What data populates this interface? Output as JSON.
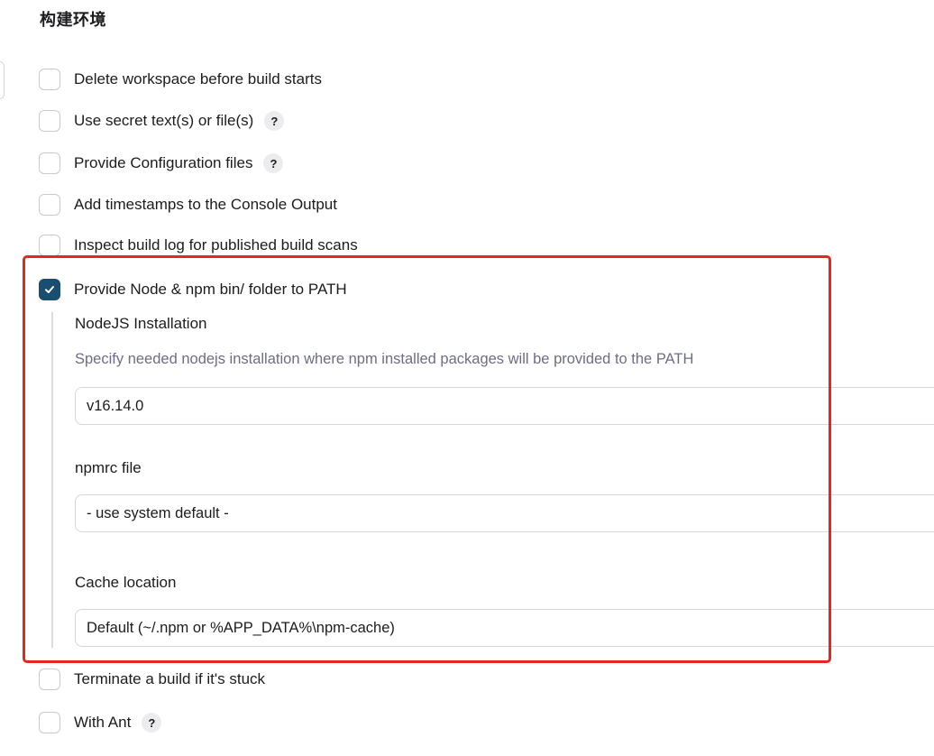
{
  "section": {
    "title": "构建环境"
  },
  "options": {
    "delete_workspace": "Delete workspace before build starts",
    "secret_text": "Use secret text(s) or file(s)",
    "config_files": "Provide Configuration files",
    "timestamps": "Add timestamps to the Console Output",
    "inspect_build_log": "Inspect build log for published build scans",
    "node_path": "Provide Node & npm bin/ folder to PATH",
    "terminate_stuck": "Terminate a build if it's stuck",
    "with_ant": "With Ant"
  },
  "help_glyph": "?",
  "node_config": {
    "installation_label": "NodeJS Installation",
    "installation_desc": "Specify needed nodejs installation where npm installed packages will be provided to the PATH",
    "installation_value": "v16.14.0",
    "npmrc_label": "npmrc file",
    "npmrc_value": "- use system default -",
    "cache_label": "Cache location",
    "cache_value": "Default (~/.npm or %APP_DATA%\\npm-cache)"
  },
  "checkbox_states": {
    "delete_workspace": false,
    "secret_text": false,
    "config_files": false,
    "timestamps": false,
    "inspect_build_log": false,
    "node_path": true,
    "terminate_stuck": false,
    "with_ant": false
  },
  "colors": {
    "checked_fill": "#1a4d6e",
    "highlight_border": "#e8251f",
    "description_text": "#6d6d85"
  },
  "icons": {
    "checkmark": "check-icon",
    "help": "help-icon"
  }
}
